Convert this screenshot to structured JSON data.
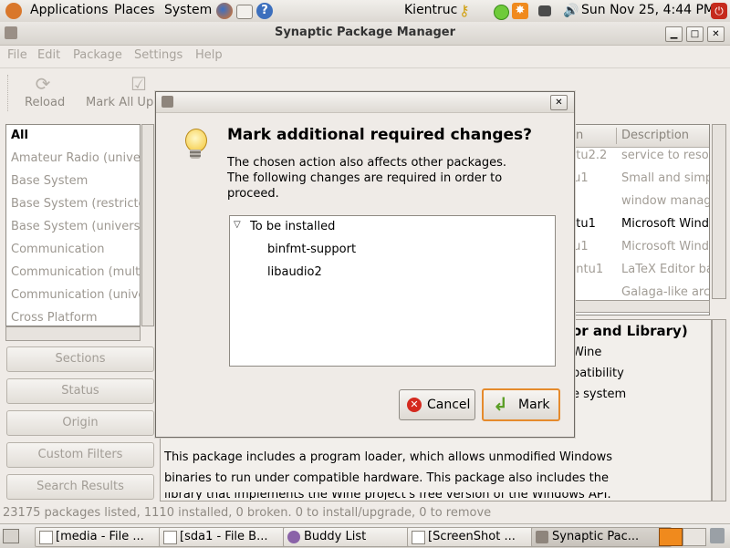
{
  "top_panel": {
    "menus": [
      "Applications",
      "Places",
      "System"
    ],
    "user": "Kientruc",
    "datetime": "Sun Nov 25,  4:44 PM"
  },
  "window": {
    "title": "Synaptic Package Manager",
    "menubar": [
      "File",
      "Edit",
      "Package",
      "Settings",
      "Help"
    ],
    "toolbar": {
      "reload": "Reload",
      "mark_all": "Mark All Upgrades"
    }
  },
  "sections": {
    "items": [
      "All",
      "Amateur Radio (universe)",
      "Base System",
      "Base System (restricted)",
      "Base System (universe)",
      "Communication",
      "Communication (multiverse)",
      "Communication (universe)",
      "Cross Platform"
    ],
    "buttons": [
      "Sections",
      "Status",
      "Origin",
      "Custom Filters",
      "Search Results"
    ]
  },
  "packages": {
    "col_version_partial": "n",
    "col_description": "Description",
    "rows": [
      {
        "version": "ntu2.2",
        "desc": "service to reso"
      },
      {
        "version": "tu1",
        "desc": "Small and simp"
      },
      {
        "version": "",
        "desc": "window manag"
      },
      {
        "version": "ntu1",
        "desc": "Microsoft Windo"
      },
      {
        "version": "tu1",
        "desc": "Microsoft Windo"
      },
      {
        "version": "untu1",
        "desc": "LaTeX Editor ba"
      },
      {
        "version": "",
        "desc": "Galaga-like arc"
      }
    ]
  },
  "description": {
    "heading_partial": "or and Library)",
    "lines_partial": [
      "Wine",
      "patibility",
      "e system"
    ],
    "body": [
      "This package includes a program loader, which allows unmodified Windows",
      "binaries to run under compatible hardware.  This package also includes the",
      "library that implements the Wine project's free version of the Windows API."
    ]
  },
  "statusbar": {
    "text": "23175 packages listed, 1110 installed, 0 broken. 0 to install/upgrade, 0 to remove"
  },
  "taskbar": {
    "tasks": [
      "[media - File ...",
      "[sda1 - File B...",
      "Buddy List",
      "[ScreenShot ...",
      "Synaptic Pac..."
    ]
  },
  "dialog": {
    "heading": "Mark additional required changes?",
    "message": [
      "The chosen action also affects other packages.",
      "The following changes are required in order to",
      "proceed."
    ],
    "group": "To be installed",
    "packages": [
      "binfmt-support",
      "libaudio2"
    ],
    "cancel_label": "Cancel",
    "mark_label": "Mark",
    "colors": {
      "mark_border": "#e58a2c",
      "cancel_icon": "#d42a1f",
      "mark_icon": "#5a9e25"
    }
  }
}
